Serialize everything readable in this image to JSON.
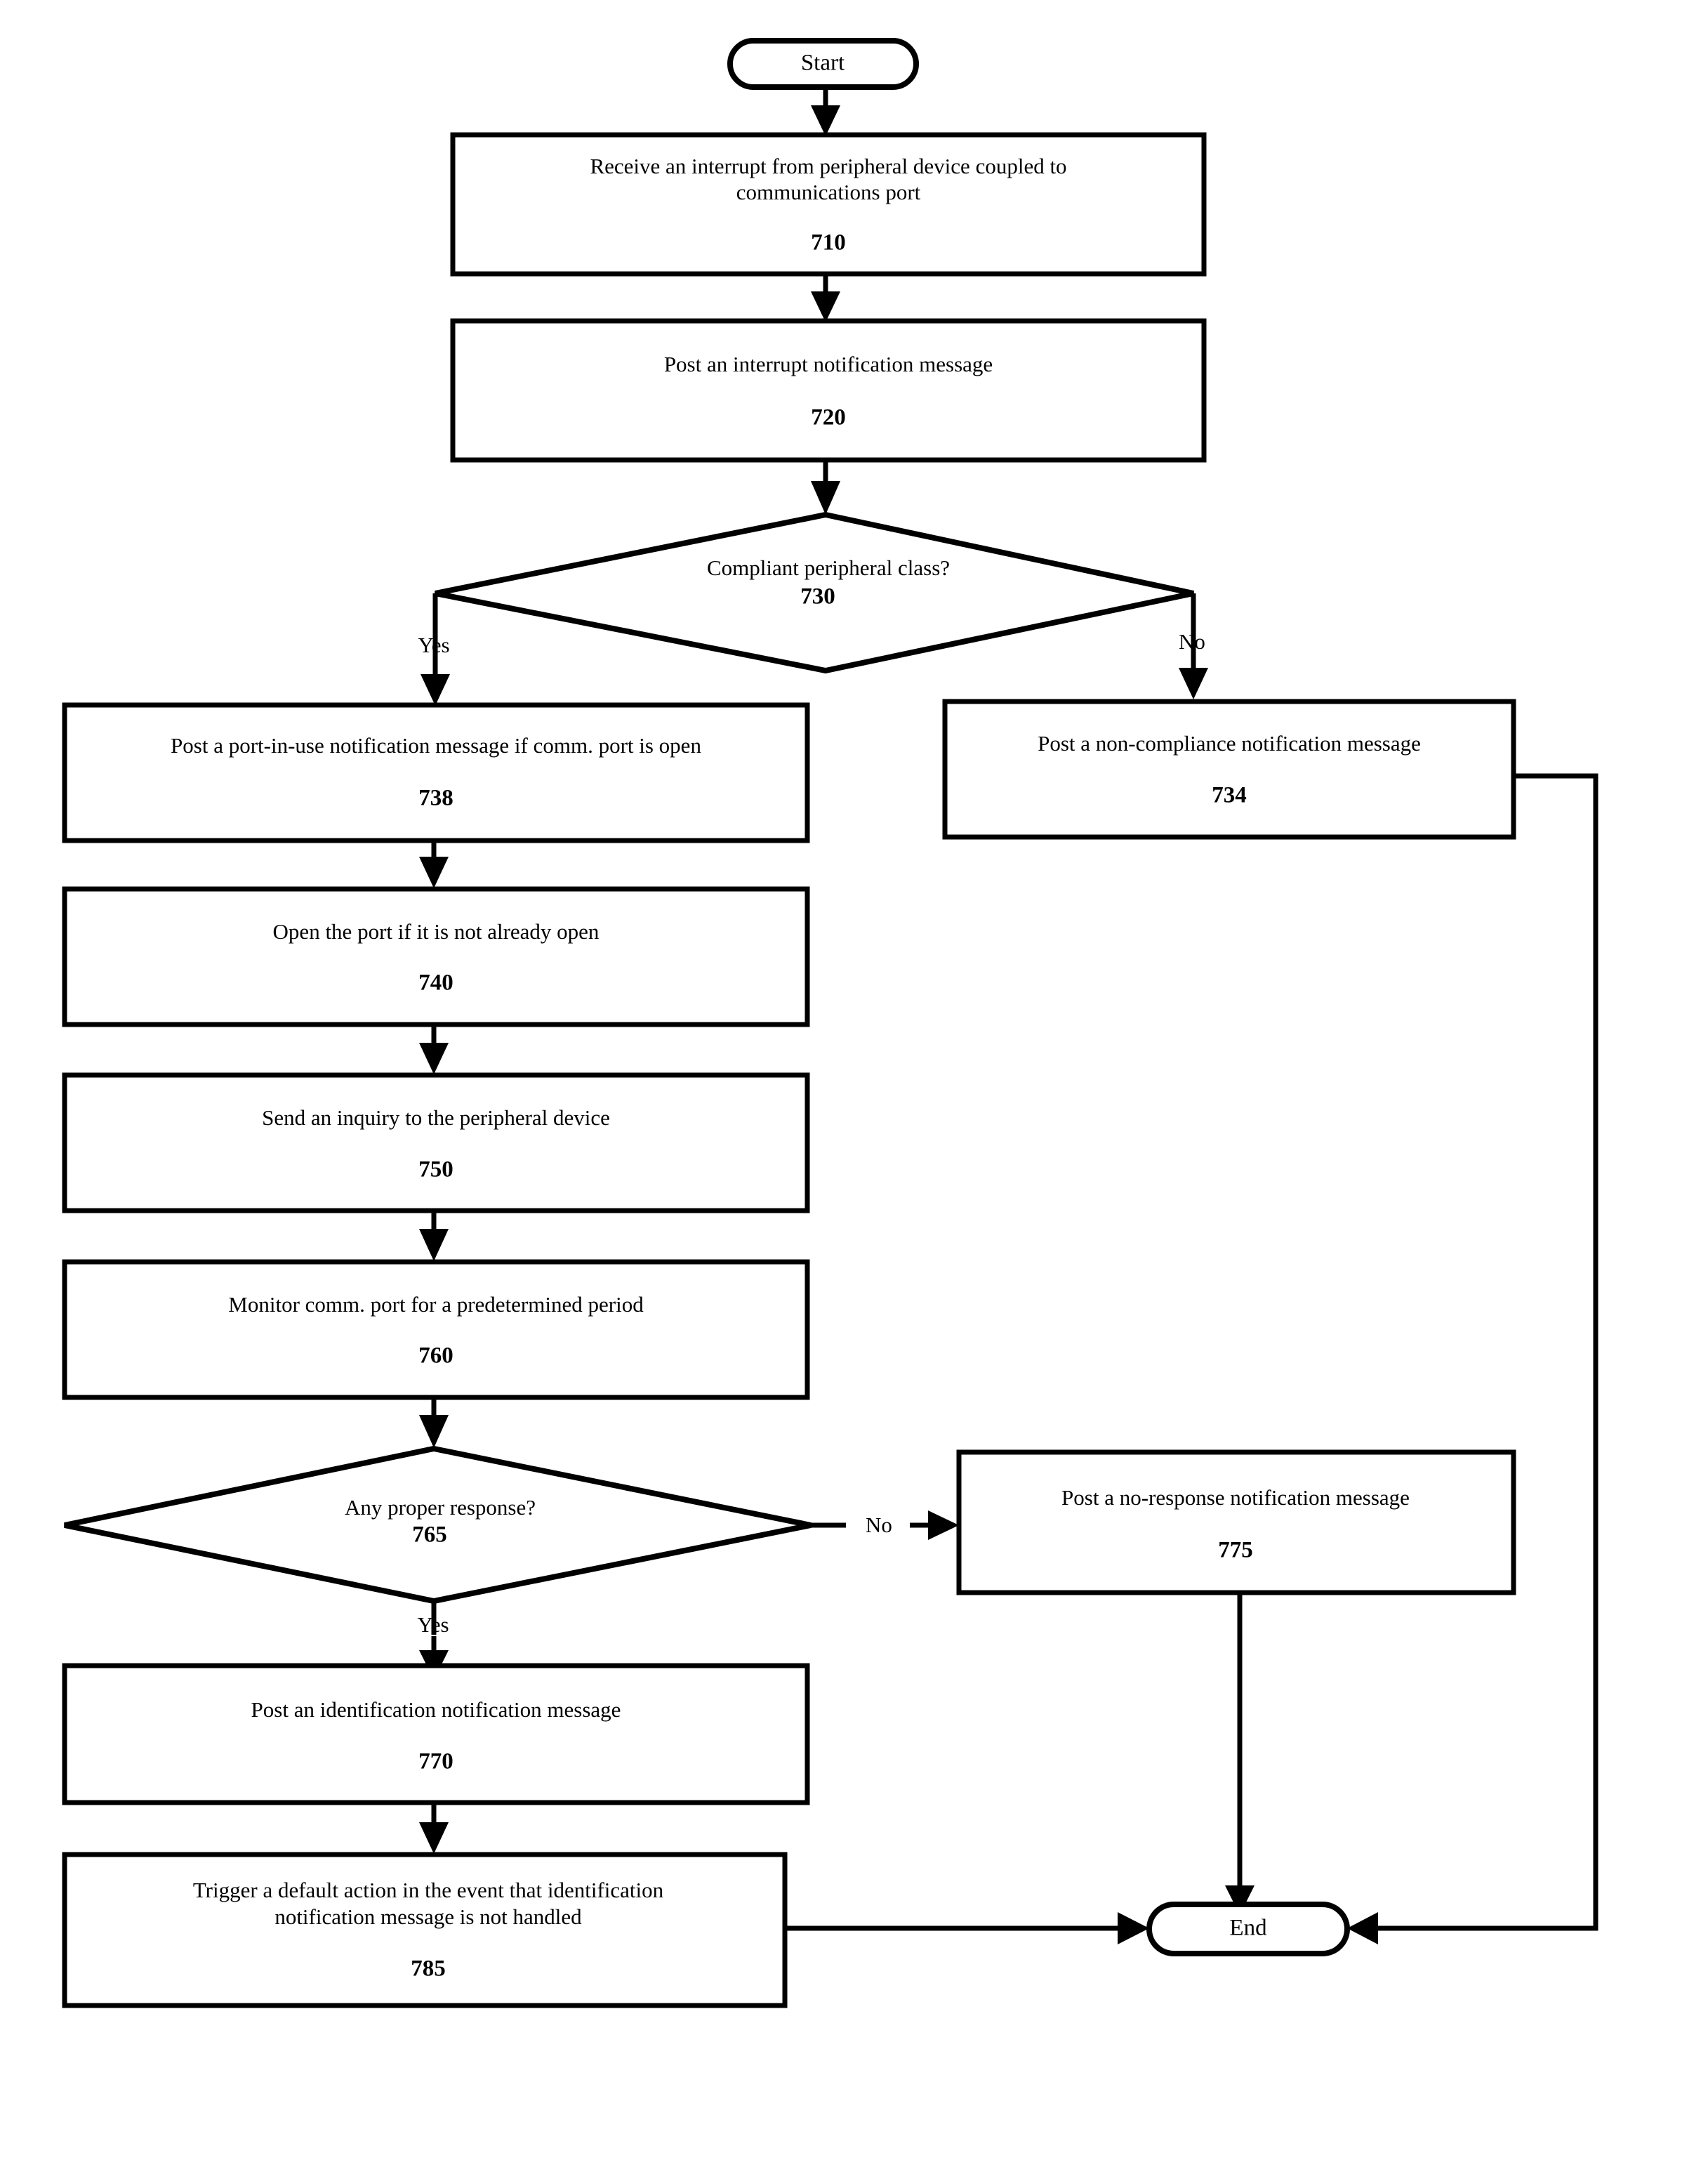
{
  "diagram": {
    "title": "Peripheral device interrupt handling flowchart",
    "terminators": {
      "start": "Start",
      "end": "End"
    },
    "nodes": [
      {
        "id": "710",
        "text_line1": "Receive an interrupt from peripheral device coupled to",
        "text_line2": "communications port",
        "ref": "710"
      },
      {
        "id": "720",
        "text_line1": "Post an interrupt notification message",
        "text_line2": "",
        "ref": "720"
      },
      {
        "id": "738",
        "text_line1": "Post a port-in-use notification message if comm. port is open",
        "text_line2": "",
        "ref": "738"
      },
      {
        "id": "734",
        "text_line1": "Post a non-compliance notification message",
        "text_line2": "",
        "ref": "734"
      },
      {
        "id": "740",
        "text_line1": "Open the port if it is not already open",
        "text_line2": "",
        "ref": "740"
      },
      {
        "id": "750",
        "text_line1": "Send an inquiry to the peripheral device",
        "text_line2": "",
        "ref": "750"
      },
      {
        "id": "760",
        "text_line1": "Monitor comm. port for a predetermined period",
        "text_line2": "",
        "ref": "760"
      },
      {
        "id": "775",
        "text_line1": "Post a no-response notification message",
        "text_line2": "",
        "ref": "775"
      },
      {
        "id": "770",
        "text_line1": "Post an identification notification message",
        "text_line2": "",
        "ref": "770"
      },
      {
        "id": "785",
        "text_line1": "Trigger a default action in the event that identification",
        "text_line2": "notification message is not handled",
        "ref": "785"
      }
    ],
    "decisions": [
      {
        "id": "730",
        "text": "Compliant peripheral class?",
        "ref": "730",
        "yes_label": "Yes",
        "no_label": "No"
      },
      {
        "id": "765",
        "text": "Any proper response?",
        "ref": "765",
        "yes_label": "Yes",
        "no_label": "No"
      }
    ],
    "edge_labels": {
      "d730_yes": "Yes",
      "d730_no": "No",
      "d765_yes": "Yes",
      "d765_no": "No"
    },
    "colors": {
      "stroke": "#000000",
      "fill": "#ffffff"
    }
  }
}
